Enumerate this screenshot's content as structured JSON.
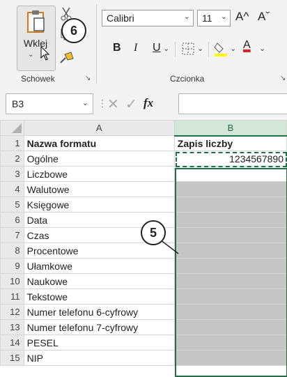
{
  "ribbon": {
    "paste_label": "Wklej",
    "clipboard_group": "Schowek",
    "font_group": "Czcionka",
    "font_name": "Calibri",
    "font_size": "11",
    "bold": "B",
    "italic": "I",
    "underline": "U",
    "grow_font": "A^",
    "shrink_font": "Aˇ",
    "font_color_letter": "A",
    "highlight_color": "#ffff00",
    "font_color": "#e02020"
  },
  "callouts": {
    "paste": "6",
    "selection": "5"
  },
  "formula_bar": {
    "name_box": "B3",
    "fx": "fx"
  },
  "sheet": {
    "columns": [
      "A",
      "B"
    ],
    "rows": [
      {
        "n": "1",
        "a": "Nazwa formatu",
        "b": "Zapis liczby"
      },
      {
        "n": "2",
        "a": "Ogólne",
        "b": "1234567890"
      },
      {
        "n": "3",
        "a": "Liczbowe",
        "b": ""
      },
      {
        "n": "4",
        "a": "Walutowe",
        "b": ""
      },
      {
        "n": "5",
        "a": "Księgowe",
        "b": ""
      },
      {
        "n": "6",
        "a": "Data",
        "b": ""
      },
      {
        "n": "7",
        "a": "Czas",
        "b": ""
      },
      {
        "n": "8",
        "a": "Procentowe",
        "b": ""
      },
      {
        "n": "9",
        "a": "Ułamkowe",
        "b": ""
      },
      {
        "n": "10",
        "a": "Naukowe",
        "b": ""
      },
      {
        "n": "11",
        "a": "Tekstowe",
        "b": ""
      },
      {
        "n": "12",
        "a": "Numer telefonu 6-cyfrowy",
        "b": ""
      },
      {
        "n": "13",
        "a": "Numer telefonu 7-cyfrowy",
        "b": ""
      },
      {
        "n": "14",
        "a": "PESEL",
        "b": ""
      },
      {
        "n": "15",
        "a": "NIP",
        "b": ""
      }
    ],
    "accent": "#1e7145"
  }
}
